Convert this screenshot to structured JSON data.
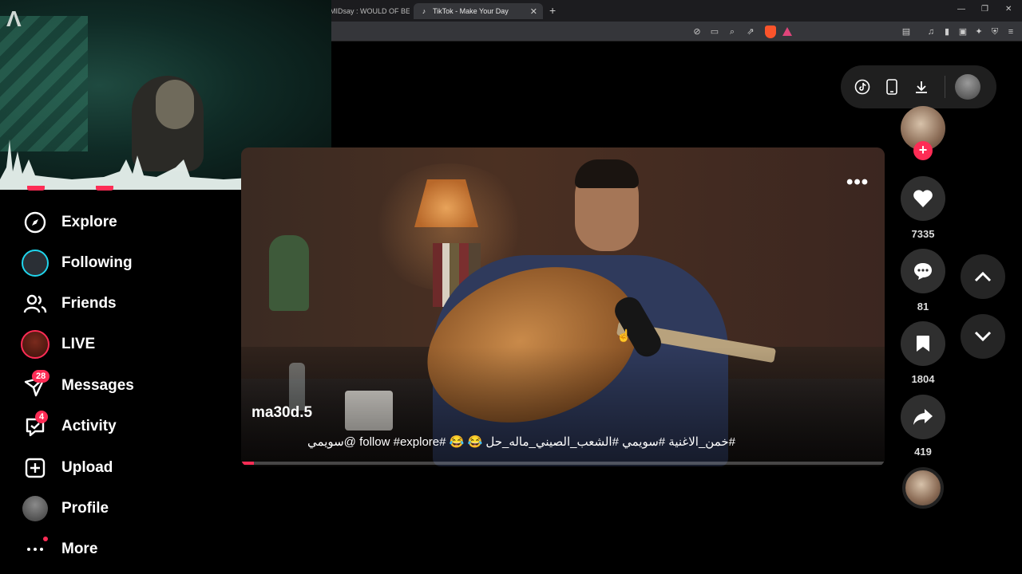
{
  "browser": {
    "prev_tab_title": "MIDsay : WOULD OF BEEN",
    "active_tab_title": "TikTok - Make Your Day",
    "close_glyph": "✕",
    "new_tab_glyph": "+"
  },
  "sidebar": {
    "items": [
      {
        "label": "Explore",
        "icon": "compass-icon"
      },
      {
        "label": "Following",
        "icon": "following-avatar"
      },
      {
        "label": "Friends",
        "icon": "friends-icon"
      },
      {
        "label": "LIVE",
        "icon": "live-avatar"
      },
      {
        "label": "Messages",
        "icon": "messages-icon",
        "badge": "28"
      },
      {
        "label": "Activity",
        "icon": "activity-icon",
        "badge": "4"
      },
      {
        "label": "Upload",
        "icon": "upload-icon"
      },
      {
        "label": "Profile",
        "icon": "profile-avatar"
      },
      {
        "label": "More",
        "icon": "more-icon"
      }
    ]
  },
  "video": {
    "author": "ma30d.5",
    "caption": "#خمن_الاغنية #سويمي #الشعب_الصيني_ماله_حل 😂 😂 #follow #explore @سويمي",
    "more_glyph": "•••",
    "progress": 0.02
  },
  "actions": {
    "likes": "7335",
    "comments": "81",
    "saves": "1804",
    "shares": "419"
  },
  "colors": {
    "accent": "#fe2c55",
    "cyan": "#20d5ec"
  }
}
